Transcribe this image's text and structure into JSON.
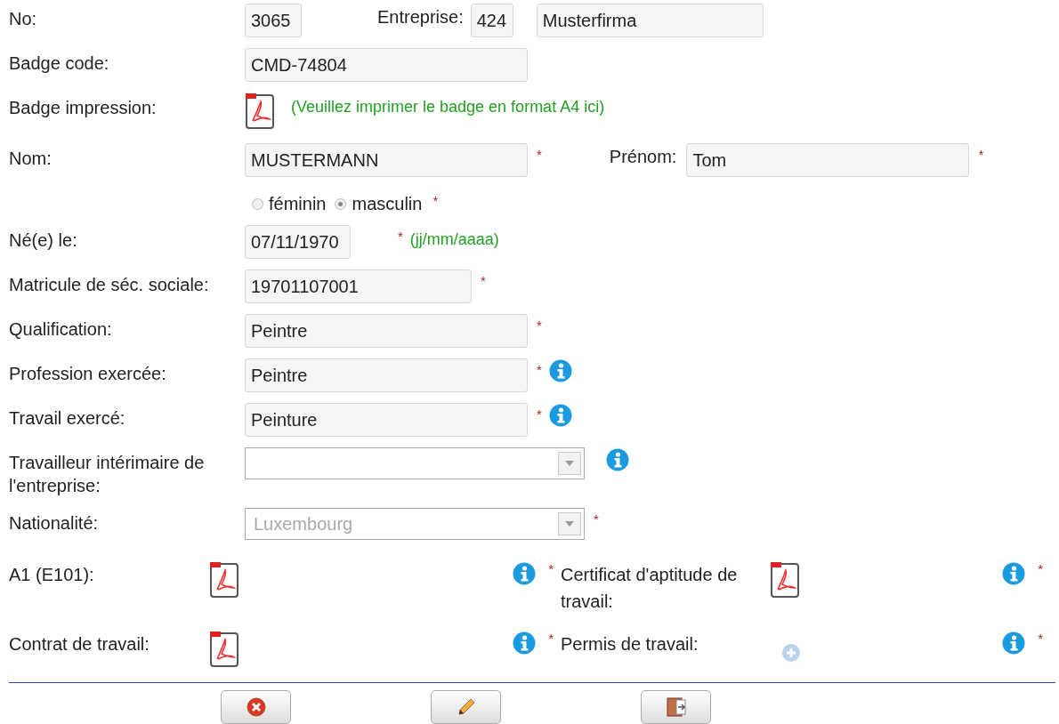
{
  "rows": [
    {
      "kind": "company",
      "label": "No:",
      "value": "3065",
      "company_label": "Entreprise:",
      "company_code": "424",
      "company_name": "Musterfirma"
    },
    {
      "kind": "text",
      "label": "Badge code:",
      "value": "CMD-74804"
    },
    {
      "kind": "print",
      "label": "Badge impression:",
      "hint": "(Veuillez imprimer le badge en format A4 ici)"
    },
    {
      "kind": "name",
      "label": "Nom:",
      "value": "MUSTERMANN",
      "mark": "*",
      "first_label": "Prénom:",
      "first_value": "Tom",
      "first_mark": "*"
    },
    {
      "kind": "gender",
      "options": [
        {
          "label": "féminin",
          "selected": false
        },
        {
          "label": "masculin",
          "selected": true
        }
      ],
      "mark": "*"
    },
    {
      "kind": "date",
      "label": "Né(e) le:",
      "value": "07/11/1970",
      "mark": "*",
      "hint": "(jj/mm/aaaa)"
    },
    {
      "kind": "id",
      "label": "Matricule de séc. sociale:",
      "value": "19701107001",
      "mark": "*"
    },
    {
      "kind": "text",
      "label": "Qualification:",
      "value": "Peintre",
      "mark": "*"
    },
    {
      "kind": "text",
      "label": "Profession exercée:",
      "value": "Peintre",
      "mark": "*",
      "info": true
    },
    {
      "kind": "text",
      "label": "Travail exercé:",
      "value": "Peinture",
      "mark": "*",
      "info": true
    },
    {
      "kind": "select",
      "label": "Travailleur intérimaire de l'entreprise:",
      "info": true
    },
    {
      "kind": "select",
      "label": "Nationalité:",
      "value": "Luxembourg",
      "mark": "*"
    }
  ],
  "documents": [
    {
      "label": "A1 (E101):",
      "kind": "pdf",
      "info": true,
      "mark": "*"
    },
    {
      "label": "Certificat d'aptitude de travail:",
      "kind": "pdf",
      "info": true,
      "mark": "*"
    },
    {
      "label": "Contrat de travail:",
      "kind": "pdf",
      "info": true,
      "mark": "*"
    },
    {
      "label": "Permis de travail:",
      "kind": "add",
      "info": true,
      "mark": "*"
    }
  ],
  "buttons": [
    {
      "kind": "cancel"
    },
    {
      "kind": "edit"
    },
    {
      "kind": "exit"
    }
  ]
}
